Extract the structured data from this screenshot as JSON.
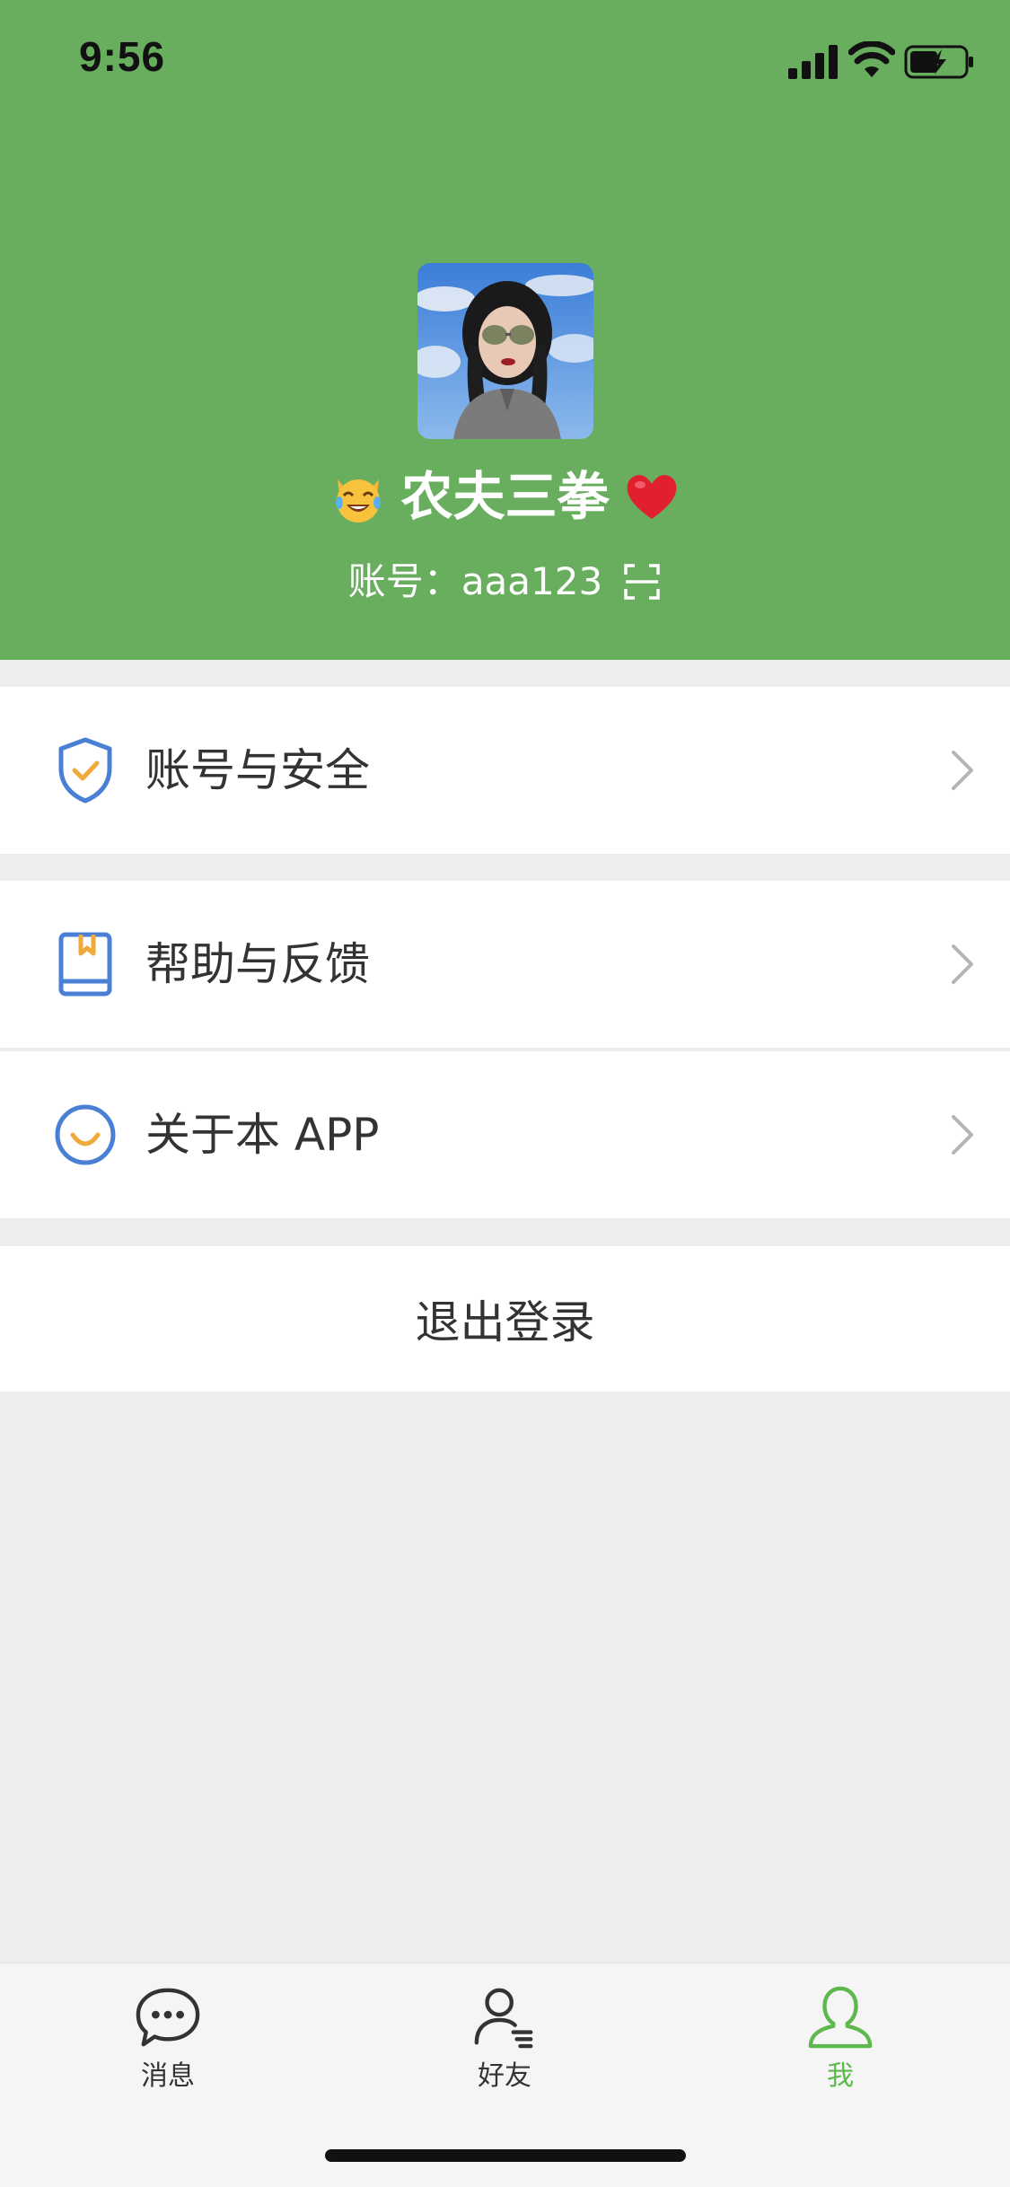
{
  "status_bar": {
    "time": "9:56"
  },
  "profile": {
    "nickname": "农夫三拳",
    "nickname_prefix_emoji": "laughing-cat-emoji",
    "nickname_suffix_emoji": "red-heart-emoji",
    "account_label": "账号：",
    "account_value": "aaa123"
  },
  "menu": {
    "items": [
      {
        "label": "账号与安全",
        "icon": "shield-check-icon"
      },
      {
        "label": "帮助与反馈",
        "icon": "book-icon"
      },
      {
        "label": "关于本 APP",
        "icon": "smile-icon"
      }
    ],
    "logout_label": "退出登录"
  },
  "tabbar": {
    "tabs": [
      {
        "label": "消息",
        "icon": "chat-bubble-icon",
        "active": false
      },
      {
        "label": "好友",
        "icon": "friends-icon",
        "active": false
      },
      {
        "label": "我",
        "icon": "person-icon",
        "active": true
      }
    ]
  },
  "colors": {
    "header_green": "#69ae5f",
    "active_tab_green": "#5db84d",
    "icon_blue": "#4a7fd6",
    "icon_orange": "#f0a93b"
  }
}
